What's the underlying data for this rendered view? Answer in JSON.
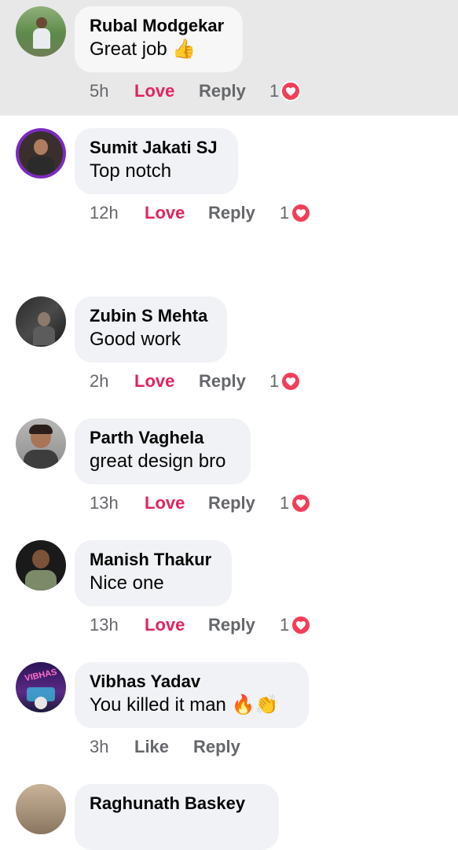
{
  "comments": [
    {
      "name": "Rubal Modgekar",
      "text": "Great job",
      "emoji": "👍",
      "time": "5h",
      "action": "Love",
      "reply": "Reply",
      "reaction_count": "1"
    },
    {
      "name": "Sumit Jakati SJ",
      "text": "Top notch",
      "emoji": "",
      "time": "12h",
      "action": "Love",
      "reply": "Reply",
      "reaction_count": "1"
    },
    {
      "name": "Zubin S Mehta",
      "text": "Good work",
      "emoji": "",
      "time": "2h",
      "action": "Love",
      "reply": "Reply",
      "reaction_count": "1"
    },
    {
      "name": "Parth Vaghela",
      "text": "great design bro",
      "emoji": "",
      "time": "13h",
      "action": "Love",
      "reply": "Reply",
      "reaction_count": "1"
    },
    {
      "name": "Manish Thakur",
      "text": "Nice one",
      "emoji": "",
      "time": "13h",
      "action": "Love",
      "reply": "Reply",
      "reaction_count": "1"
    },
    {
      "name": "Vibhas Yadav",
      "text": "You killed it man",
      "emoji": "🔥👏",
      "time": "3h",
      "action": "Like",
      "reply": "Reply",
      "reaction_count": ""
    },
    {
      "name": "Raghunath Baskey",
      "text": "",
      "emoji": "",
      "time": "",
      "action": "",
      "reply": "",
      "reaction_count": ""
    }
  ],
  "avatar_labels": {
    "vibhas": "VIBHAS"
  },
  "colors": {
    "love": "#e0245e",
    "heart": "#f33e58",
    "bubble": "#f0f2f5",
    "highlight": "#e8e8e8",
    "muted": "#65676b"
  }
}
